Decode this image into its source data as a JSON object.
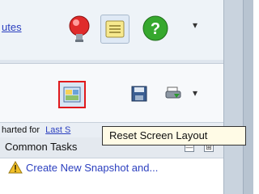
{
  "header": {
    "link_partial": "utes"
  },
  "toolbar": {
    "reset_layout_tooltip": "Reset Screen Layout",
    "dropdown_arrow": "▾"
  },
  "subheader": {
    "prefix": "harted for",
    "link": "Last S"
  },
  "common_tasks": {
    "title": "Common Tasks",
    "minimize": "—",
    "pin": "⊞",
    "items": [
      {
        "label": "Create New Snapshot and..."
      }
    ]
  },
  "colors": {
    "accent": "#e0191c",
    "link": "#2b3fbf"
  }
}
